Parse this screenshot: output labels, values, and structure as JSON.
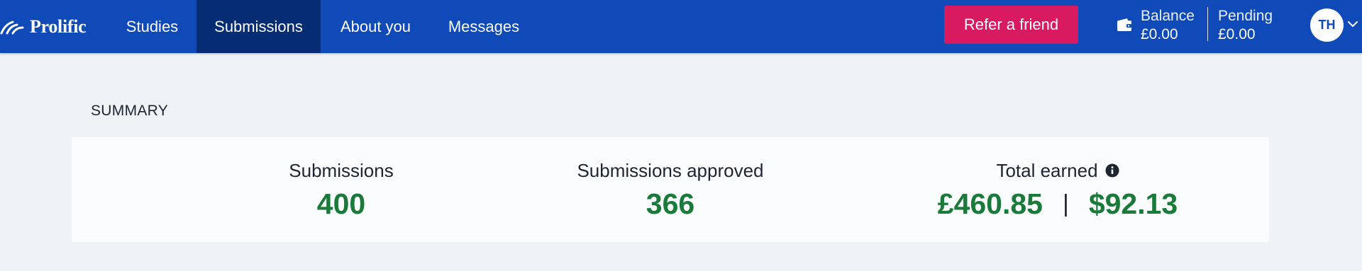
{
  "brand": {
    "name": "Prolific"
  },
  "nav": {
    "tabs": [
      {
        "label": "Studies",
        "active": false
      },
      {
        "label": "Submissions",
        "active": true
      },
      {
        "label": "About you",
        "active": false
      },
      {
        "label": "Messages",
        "active": false
      }
    ],
    "refer_label": "Refer a friend",
    "balance_label": "Balance",
    "balance_value": "£0.00",
    "pending_label": "Pending",
    "pending_value": "£0.00",
    "avatar_initials": "TH"
  },
  "summary": {
    "heading": "SUMMARY",
    "submissions_label": "Submissions",
    "submissions_value": "400",
    "approved_label": "Submissions approved",
    "approved_value": "366",
    "earned_label": "Total earned",
    "earned_gbp": "£460.85",
    "earned_separator": "|",
    "earned_usd": "$92.13"
  },
  "colors": {
    "nav_bg": "#0f4ab8",
    "nav_active": "#062c74",
    "refer_button": "#d81b60",
    "value_green": "#1a7a3a",
    "page_bg": "#eff3f6"
  },
  "icons": [
    "prolific-logo-icon",
    "wallet-icon",
    "chevron-down-icon",
    "info-icon"
  ]
}
